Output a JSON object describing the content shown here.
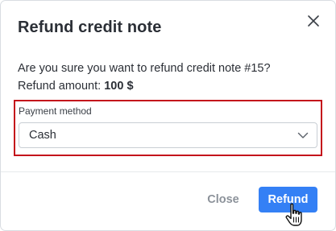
{
  "dialog": {
    "title": "Refund credit note",
    "message": "Are you sure you want to refund credit note #15?",
    "amount_label": "Refund amount:",
    "amount_value": "100 $"
  },
  "payment_method": {
    "label": "Payment method",
    "selected": "Cash"
  },
  "buttons": {
    "close_label": "Close",
    "refund_label": "Refund"
  },
  "colors": {
    "primary": "#3480f5",
    "highlight_border": "#c4131b",
    "muted_button_text": "#8c929a"
  },
  "icons": {
    "close": "close-icon",
    "dropdown": "chevron-down-icon",
    "pointer": "hand-pointer-cursor-icon"
  }
}
